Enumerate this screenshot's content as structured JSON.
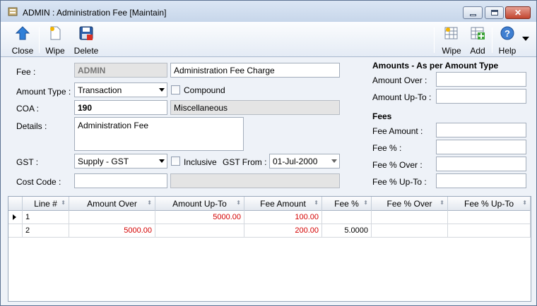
{
  "window": {
    "title": "ADMIN : Administration Fee [Maintain]"
  },
  "toolbar": {
    "close_label": "Close",
    "wipe_label": "Wipe",
    "delete_label": "Delete",
    "wipe2_label": "Wipe",
    "add_label": "Add",
    "help_label": "Help"
  },
  "form": {
    "fee_label": "Fee :",
    "fee_code": "ADMIN",
    "fee_description": "Administration Fee Charge",
    "amount_type_label": "Amount Type :",
    "amount_type_value": "Transaction",
    "compound_label": "Compound",
    "coa_label": "COA :",
    "coa_value": "190",
    "coa_description": "Miscellaneous",
    "details_label": "Details :",
    "details_value": "Administration Fee",
    "gst_label": "GST :",
    "gst_value": "Supply - GST",
    "inclusive_label": "Inclusive",
    "gst_from_label": "GST From :",
    "gst_from_value": "01-Jul-2000",
    "cost_code_label": "Cost Code :",
    "cost_code_value": "",
    "cost_code_description": ""
  },
  "amounts": {
    "title": "Amounts - As per Amount Type",
    "over_label": "Amount Over :",
    "over_value": "",
    "upto_label": "Amount Up-To :",
    "upto_value": ""
  },
  "fees": {
    "title": "Fees",
    "amount_label": "Fee Amount :",
    "amount_value": "",
    "pct_label": "Fee % :",
    "pct_value": "",
    "pct_over_label": "Fee % Over :",
    "pct_over_value": "",
    "pct_upto_label": "Fee % Up-To :",
    "pct_upto_value": ""
  },
  "grid": {
    "columns": [
      "Line #",
      "Amount Over",
      "Amount Up-To",
      "Fee Amount",
      "Fee %",
      "Fee % Over",
      "Fee % Up-To"
    ],
    "rows": [
      {
        "line": "1",
        "amount_over": "",
        "amount_upto": "5000.00",
        "fee_amount": "100.00",
        "fee_pct": "",
        "fee_pct_over": "",
        "fee_pct_upto": ""
      },
      {
        "line": "2",
        "amount_over": "5000.00",
        "amount_upto": "",
        "fee_amount": "200.00",
        "fee_pct": "5.0000",
        "fee_pct_over": "",
        "fee_pct_upto": ""
      }
    ]
  },
  "colors": {
    "accent_red": "#d40000",
    "title_gradient": "#c7d6ea"
  }
}
